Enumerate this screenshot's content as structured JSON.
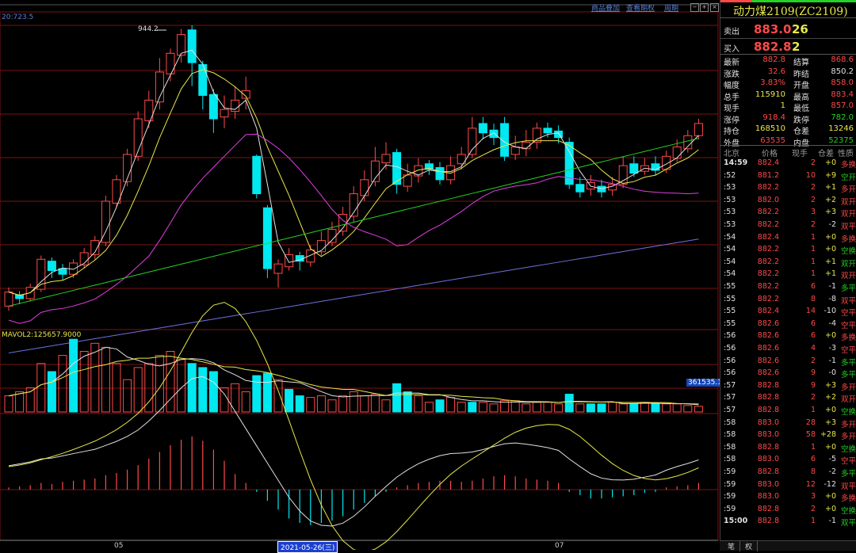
{
  "toolbar": {
    "links": [
      "商品叠加",
      "查看期权",
      "周期"
    ]
  },
  "main_chart": {
    "ma_label": "20:723.5",
    "high_label": "944.2"
  },
  "volume_panel": {
    "label": "MAVOL2:125657.9000",
    "price_tag": "361535.1"
  },
  "x_axis": {
    "labels": [
      "05",
      "07"
    ],
    "cursor_date": "2021-05-26(三)"
  },
  "quote": {
    "title": "动力煤2109(ZC2109)",
    "sell": {
      "label": "卖出",
      "price": "883.0",
      "qty": "26"
    },
    "buy": {
      "label": "买入",
      "price": "882.8",
      "qty": "2"
    },
    "stats": [
      {
        "l1": "最新",
        "v1": "882.8",
        "c1": "red",
        "l2": "结算",
        "v2": "868.6",
        "c2": "red"
      },
      {
        "l1": "涨跌",
        "v1": "32.6",
        "c1": "red",
        "l2": "昨结",
        "v2": "850.2",
        "c2": "wht"
      },
      {
        "l1": "幅度",
        "v1": "3.83%",
        "c1": "red",
        "l2": "开盘",
        "v2": "858.0",
        "c2": "red"
      },
      {
        "l1": "总手",
        "v1": "115910",
        "c1": "yel",
        "l2": "最高",
        "v2": "883.4",
        "c2": "red"
      },
      {
        "l1": "现手",
        "v1": "1",
        "c1": "yel",
        "l2": "最低",
        "v2": "857.0",
        "c2": "red"
      },
      {
        "l1": "涨停",
        "v1": "918.4",
        "c1": "red",
        "l2": "跌停",
        "v2": "782.0",
        "c2": "grn"
      },
      {
        "l1": "持仓",
        "v1": "168510",
        "c1": "yel",
        "l2": "仓差",
        "v2": "13246",
        "c2": "yel"
      },
      {
        "l1": "外盘",
        "v1": "63535",
        "c1": "red",
        "l2": "内盘",
        "v2": "52375",
        "c2": "grn"
      }
    ],
    "tick_header": [
      "北京",
      "价格",
      "现手",
      "仓差",
      "性质"
    ],
    "ticks": [
      {
        "t": "14:59",
        "p": "882.4",
        "v": "2",
        "d": "+0",
        "n": "多换",
        "pc": "red",
        "nc": "red"
      },
      {
        "t": ":52",
        "p": "881.2",
        "v": "10",
        "d": "+9",
        "n": "空开",
        "pc": "red",
        "nc": "grn"
      },
      {
        "t": ":53",
        "p": "882.2",
        "v": "2",
        "d": "+1",
        "n": "多开",
        "pc": "red",
        "nc": "red"
      },
      {
        "t": ":53",
        "p": "882.0",
        "v": "2",
        "d": "+2",
        "n": "双开",
        "pc": "red",
        "nc": "red"
      },
      {
        "t": ":53",
        "p": "882.2",
        "v": "3",
        "d": "+3",
        "n": "双开",
        "pc": "red",
        "nc": "red"
      },
      {
        "t": ":53",
        "p": "882.2",
        "v": "2",
        "d": "-2",
        "n": "双平",
        "pc": "red",
        "nc": "red"
      },
      {
        "t": ":54",
        "p": "882.4",
        "v": "1",
        "d": "+0",
        "n": "多换",
        "pc": "red",
        "nc": "red"
      },
      {
        "t": ":54",
        "p": "882.2",
        "v": "1",
        "d": "+0",
        "n": "空换",
        "pc": "red",
        "nc": "grn"
      },
      {
        "t": ":54",
        "p": "882.2",
        "v": "1",
        "d": "+1",
        "n": "双开",
        "pc": "red",
        "nc": "grn"
      },
      {
        "t": ":54",
        "p": "882.2",
        "v": "1",
        "d": "+1",
        "n": "双开",
        "pc": "red",
        "nc": "red"
      },
      {
        "t": ":55",
        "p": "882.2",
        "v": "6",
        "d": "-1",
        "n": "多平",
        "pc": "red",
        "nc": "grn"
      },
      {
        "t": ":55",
        "p": "882.2",
        "v": "8",
        "d": "-8",
        "n": "双平",
        "pc": "red",
        "nc": "red"
      },
      {
        "t": ":55",
        "p": "882.4",
        "v": "14",
        "d": "-10",
        "n": "空平",
        "pc": "red",
        "nc": "red"
      },
      {
        "t": ":55",
        "p": "882.6",
        "v": "6",
        "d": "-4",
        "n": "空平",
        "pc": "red",
        "nc": "red"
      },
      {
        "t": ":56",
        "p": "882.6",
        "v": "6",
        "d": "+0",
        "n": "多换",
        "pc": "red",
        "nc": "red"
      },
      {
        "t": ":56",
        "p": "882.6",
        "v": "4",
        "d": "-3",
        "n": "空平",
        "pc": "red",
        "nc": "red"
      },
      {
        "t": ":56",
        "p": "882.6",
        "v": "2",
        "d": "-1",
        "n": "多平",
        "pc": "red",
        "nc": "grn"
      },
      {
        "t": ":56",
        "p": "882.6",
        "v": "9",
        "d": "-0",
        "n": "多平",
        "pc": "red",
        "nc": "grn"
      },
      {
        "t": ":57",
        "p": "882.8",
        "v": "9",
        "d": "+3",
        "n": "多开",
        "pc": "red",
        "nc": "red"
      },
      {
        "t": ":57",
        "p": "882.8",
        "v": "2",
        "d": "+2",
        "n": "双开",
        "pc": "red",
        "nc": "red"
      },
      {
        "t": ":57",
        "p": "882.8",
        "v": "1",
        "d": "+0",
        "n": "空换",
        "pc": "red",
        "nc": "grn"
      },
      {
        "t": ":58",
        "p": "883.0",
        "v": "28",
        "d": "+3",
        "n": "多开",
        "pc": "red",
        "nc": "red"
      },
      {
        "t": ":58",
        "p": "883.0",
        "v": "58",
        "d": "+28",
        "n": "多开",
        "pc": "red",
        "nc": "red"
      },
      {
        "t": ":58",
        "p": "882.8",
        "v": "1",
        "d": "+0",
        "n": "空换",
        "pc": "red",
        "nc": "grn"
      },
      {
        "t": ":58",
        "p": "883.0",
        "v": "6",
        "d": "-5",
        "n": "空平",
        "pc": "red",
        "nc": "red"
      },
      {
        "t": ":59",
        "p": "882.8",
        "v": "8",
        "d": "-2",
        "n": "多平",
        "pc": "red",
        "nc": "grn"
      },
      {
        "t": ":59",
        "p": "883.0",
        "v": "12",
        "d": "-12",
        "n": "双平",
        "pc": "red",
        "nc": "red"
      },
      {
        "t": ":59",
        "p": "883.0",
        "v": "3",
        "d": "+0",
        "n": "多换",
        "pc": "red",
        "nc": "red"
      },
      {
        "t": ":59",
        "p": "882.8",
        "v": "2",
        "d": "+0",
        "n": "空换",
        "pc": "red",
        "nc": "grn"
      },
      {
        "t": "15:00",
        "p": "882.8",
        "v": "1",
        "d": "-1",
        "n": "双平",
        "pc": "red",
        "nc": "grn"
      }
    ],
    "tabs": [
      "笔",
      "权"
    ]
  },
  "candles": [
    {
      "o": 850,
      "c": 865,
      "h": 870,
      "l": 845
    },
    {
      "o": 862,
      "c": 858,
      "h": 866,
      "l": 852
    },
    {
      "o": 858,
      "c": 870,
      "h": 874,
      "l": 855
    },
    {
      "o": 868,
      "c": 900,
      "h": 904,
      "l": 865
    },
    {
      "o": 898,
      "c": 888,
      "h": 902,
      "l": 880
    },
    {
      "o": 890,
      "c": 884,
      "h": 895,
      "l": 878
    },
    {
      "o": 884,
      "c": 896,
      "h": 900,
      "l": 880
    },
    {
      "o": 894,
      "c": 907,
      "h": 912,
      "l": 890
    },
    {
      "o": 905,
      "c": 920,
      "h": 925,
      "l": 900
    },
    {
      "o": 918,
      "c": 962,
      "h": 968,
      "l": 914
    },
    {
      "o": 960,
      "c": 985,
      "h": 990,
      "l": 955
    },
    {
      "o": 983,
      "c": 1012,
      "h": 1018,
      "l": 978
    },
    {
      "o": 1010,
      "c": 1050,
      "h": 1058,
      "l": 1005
    },
    {
      "o": 1048,
      "c": 1070,
      "h": 1080,
      "l": 1040
    },
    {
      "o": 1068,
      "c": 1100,
      "h": 1115,
      "l": 1060
    },
    {
      "o": 1098,
      "c": 1120,
      "h": 1125,
      "l": 1090
    },
    {
      "o": 1118,
      "c": 1140,
      "h": 1146,
      "l": 1110
    },
    {
      "o": 1145,
      "c": 1110,
      "h": 1150,
      "l": 1085
    },
    {
      "o": 1108,
      "c": 1075,
      "h": 1112,
      "l": 1060
    },
    {
      "o": 1076,
      "c": 1050,
      "h": 1082,
      "l": 1035
    },
    {
      "o": 1052,
      "c": 1060,
      "h": 1075,
      "l": 1040
    },
    {
      "o": 1058,
      "c": 1070,
      "h": 1085,
      "l": 1050
    },
    {
      "o": 1072,
      "c": 1080,
      "h": 1095,
      "l": 1060
    },
    {
      "o": 1010,
      "c": 970,
      "h": 1012,
      "l": 965
    },
    {
      "o": 955,
      "c": 890,
      "h": 958,
      "l": 880
    },
    {
      "o": 885,
      "c": 895,
      "h": 900,
      "l": 870
    },
    {
      "o": 892,
      "c": 905,
      "h": 912,
      "l": 888
    },
    {
      "o": 904,
      "c": 898,
      "h": 908,
      "l": 888
    },
    {
      "o": 897,
      "c": 910,
      "h": 915,
      "l": 892
    },
    {
      "o": 908,
      "c": 920,
      "h": 930,
      "l": 904
    },
    {
      "o": 918,
      "c": 932,
      "h": 940,
      "l": 914
    },
    {
      "o": 930,
      "c": 948,
      "h": 956,
      "l": 925
    },
    {
      "o": 946,
      "c": 970,
      "h": 978,
      "l": 940
    },
    {
      "o": 968,
      "c": 985,
      "h": 995,
      "l": 962
    },
    {
      "o": 983,
      "c": 1005,
      "h": 1020,
      "l": 978
    },
    {
      "o": 1003,
      "c": 1012,
      "h": 1025,
      "l": 996
    },
    {
      "o": 1014,
      "c": 980,
      "h": 1018,
      "l": 970
    },
    {
      "o": 978,
      "c": 990,
      "h": 1002,
      "l": 972
    },
    {
      "o": 989,
      "c": 1000,
      "h": 1008,
      "l": 982
    },
    {
      "o": 1002,
      "c": 996,
      "h": 1006,
      "l": 990
    },
    {
      "o": 998,
      "c": 985,
      "h": 1004,
      "l": 980
    },
    {
      "o": 985,
      "c": 1000,
      "h": 1010,
      "l": 980
    },
    {
      "o": 1002,
      "c": 1012,
      "h": 1020,
      "l": 996
    },
    {
      "o": 1012,
      "c": 1040,
      "h": 1052,
      "l": 1008
    },
    {
      "o": 1045,
      "c": 1035,
      "h": 1052,
      "l": 1028
    },
    {
      "o": 1038,
      "c": 1030,
      "h": 1045,
      "l": 1022
    },
    {
      "o": 1045,
      "c": 1010,
      "h": 1052,
      "l": 1005
    },
    {
      "o": 1012,
      "c": 1020,
      "h": 1032,
      "l": 1006
    },
    {
      "o": 1018,
      "c": 1025,
      "h": 1038,
      "l": 1010
    },
    {
      "o": 1025,
      "c": 1040,
      "h": 1046,
      "l": 1018
    },
    {
      "o": 1040,
      "c": 1035,
      "h": 1046,
      "l": 1030
    },
    {
      "o": 1037,
      "c": 1030,
      "h": 1043,
      "l": 1024
    },
    {
      "o": 1025,
      "c": 980,
      "h": 1030,
      "l": 975
    },
    {
      "o": 980,
      "c": 972,
      "h": 988,
      "l": 966
    },
    {
      "o": 975,
      "c": 982,
      "h": 990,
      "l": 968
    },
    {
      "o": 978,
      "c": 972,
      "h": 985,
      "l": 966
    },
    {
      "o": 974,
      "c": 980,
      "h": 988,
      "l": 968
    },
    {
      "o": 980,
      "c": 1000,
      "h": 1010,
      "l": 976
    },
    {
      "o": 1002,
      "c": 992,
      "h": 1010,
      "l": 988
    },
    {
      "o": 994,
      "c": 1000,
      "h": 1008,
      "l": 990
    },
    {
      "o": 1002,
      "c": 995,
      "h": 1010,
      "l": 990
    },
    {
      "o": 996,
      "c": 1010,
      "h": 1016,
      "l": 992
    },
    {
      "o": 1008,
      "c": 1020,
      "h": 1028,
      "l": 1004
    },
    {
      "o": 1018,
      "c": 1032,
      "h": 1038,
      "l": 1014
    },
    {
      "o": 1032,
      "c": 1045,
      "h": 1050,
      "l": 1028
    }
  ],
  "volumes": [
    [
      20,
      "r"
    ],
    [
      25,
      "r"
    ],
    [
      30,
      "r"
    ],
    [
      60,
      "r"
    ],
    [
      50,
      "c"
    ],
    [
      70,
      "r"
    ],
    [
      90,
      "c"
    ],
    [
      75,
      "r"
    ],
    [
      85,
      "r"
    ],
    [
      80,
      "r"
    ],
    [
      60,
      "r"
    ],
    [
      40,
      "r"
    ],
    [
      55,
      "r"
    ],
    [
      60,
      "r"
    ],
    [
      70,
      "r"
    ],
    [
      75,
      "r"
    ],
    [
      65,
      "r"
    ],
    [
      60,
      "c"
    ],
    [
      55,
      "c"
    ],
    [
      50,
      "c"
    ],
    [
      30,
      "r"
    ],
    [
      35,
      "r"
    ],
    [
      25,
      "r"
    ],
    [
      45,
      "c"
    ],
    [
      48,
      "c"
    ],
    [
      40,
      "r"
    ],
    [
      28,
      "c"
    ],
    [
      20,
      "c"
    ],
    [
      18,
      "r"
    ],
    [
      20,
      "r"
    ],
    [
      15,
      "r"
    ],
    [
      20,
      "r"
    ],
    [
      25,
      "r"
    ],
    [
      20,
      "r"
    ],
    [
      22,
      "r"
    ],
    [
      15,
      "r"
    ],
    [
      35,
      "c"
    ],
    [
      25,
      "c"
    ],
    [
      20,
      "r"
    ],
    [
      12,
      "r"
    ],
    [
      15,
      "c"
    ],
    [
      18,
      "r"
    ],
    [
      12,
      "r"
    ],
    [
      12,
      "c"
    ],
    [
      12,
      "r"
    ],
    [
      10,
      "r"
    ],
    [
      14,
      "r"
    ],
    [
      14,
      "r"
    ],
    [
      10,
      "r"
    ],
    [
      12,
      "r"
    ],
    [
      12,
      "r"
    ],
    [
      10,
      "r"
    ],
    [
      22,
      "c"
    ],
    [
      10,
      "r"
    ],
    [
      10,
      "c"
    ],
    [
      10,
      "c"
    ],
    [
      12,
      "r"
    ],
    [
      10,
      "r"
    ],
    [
      10,
      "c"
    ],
    [
      12,
      "r"
    ],
    [
      10,
      "c"
    ],
    [
      10,
      "r"
    ],
    [
      10,
      "r"
    ],
    [
      8,
      "r"
    ],
    [
      7,
      "r"
    ]
  ],
  "macd_hist": [
    2,
    3,
    4,
    6,
    5,
    7,
    8,
    9,
    10,
    13,
    15,
    18,
    22,
    28,
    34,
    40,
    45,
    48,
    44,
    36,
    26,
    14,
    6,
    -2,
    -10,
    -18,
    -26,
    -30,
    -32,
    -30,
    -28,
    -24,
    -18,
    -12,
    -6,
    -2,
    2,
    4,
    6,
    7,
    8,
    8,
    7,
    8,
    10,
    12,
    13,
    12,
    10,
    9,
    8,
    6,
    -2,
    -5,
    -8,
    -8,
    -7,
    -6,
    -5,
    -3,
    -2,
    2,
    3,
    4,
    6
  ],
  "colors": {
    "up": "#ff4a4a",
    "down": "#00e8f0",
    "ma5": "#e0e0e0",
    "ma10": "#e8e84a",
    "ma20": "#e040e0",
    "ma40": "#23d223",
    "ma60": "#7070e0",
    "grid": "#7a1414"
  }
}
